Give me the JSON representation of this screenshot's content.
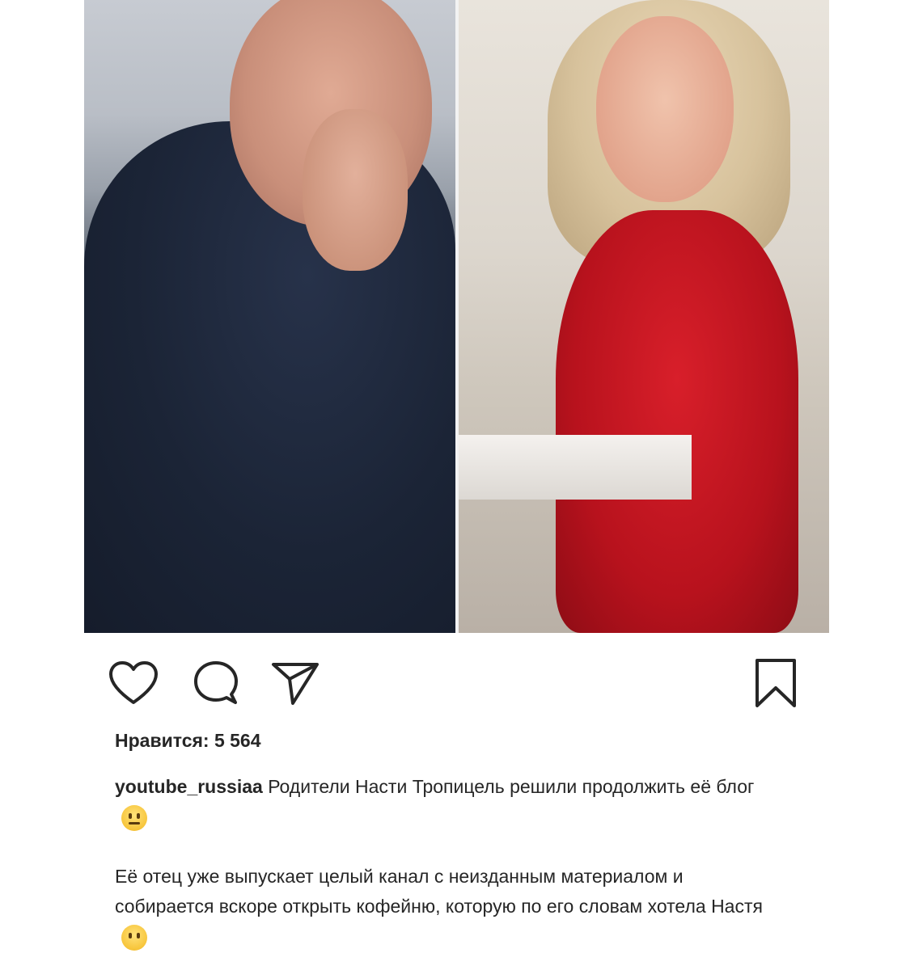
{
  "post": {
    "likes_label": "Нравится: 5 564",
    "caption": {
      "username": "youtube_russiaa",
      "text": "Родители Насти Тропицель решили продолжить её блог"
    },
    "body_text": "Её отец уже выпускает целый канал с неизданным материалом и собирается вскоре открыть кофейню, которую по его словам хотела Настя"
  },
  "actions": {
    "like_icon": "heart-icon",
    "comment_icon": "comment-icon",
    "share_icon": "paper-plane-icon",
    "save_icon": "bookmark-icon"
  },
  "emojis": [
    "neutral-face-emoji",
    "face-without-mouth-emoji"
  ],
  "colors": {
    "text": "#262626",
    "icon": "#262626",
    "background": "#ffffff",
    "dress": "#c4131f"
  }
}
